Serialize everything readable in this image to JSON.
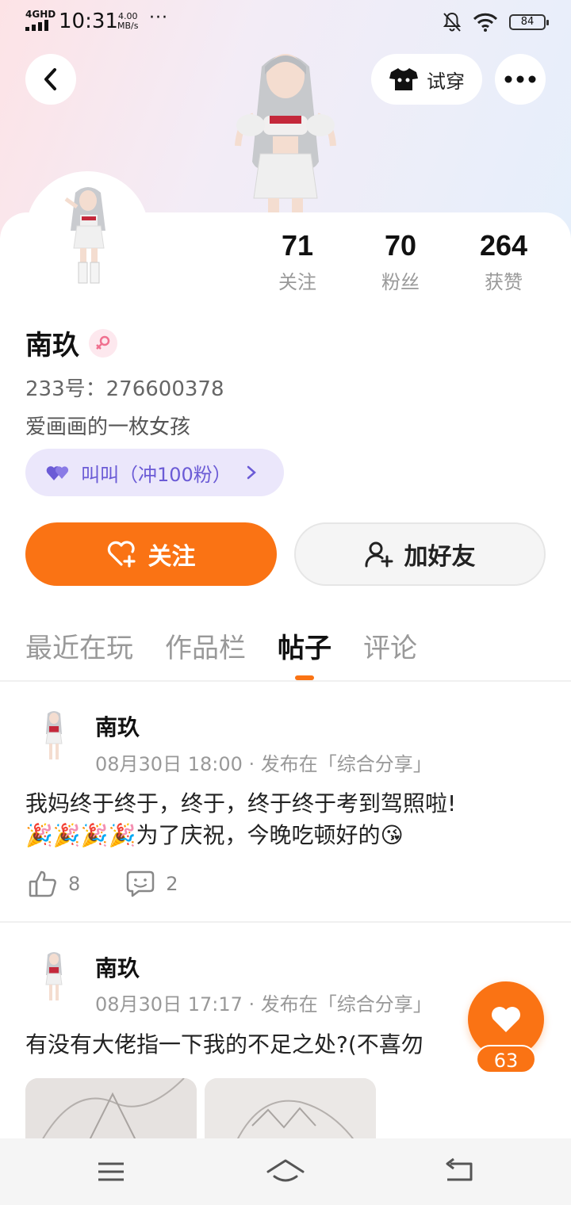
{
  "status_bar": {
    "network": "4GHD",
    "time": "10:31",
    "speed": "4.00",
    "speed_unit": "MB/s",
    "dots": "···",
    "battery": "84"
  },
  "header": {
    "tryon_label": "试穿"
  },
  "profile": {
    "name": "南玖",
    "uid": "233号：276600378",
    "bio": "爱画画的一枚女孩",
    "tag": "叫叫（冲100粉）",
    "stats": [
      {
        "value": "71",
        "label": "关注"
      },
      {
        "value": "70",
        "label": "粉丝"
      },
      {
        "value": "264",
        "label": "获赞"
      }
    ]
  },
  "actions": {
    "follow_label": "关注",
    "add_friend_label": "加好友"
  },
  "tabs": [
    "最近在玩",
    "作品栏",
    "帖子",
    "评论"
  ],
  "active_tab": "帖子",
  "posts": [
    {
      "author": "南玖",
      "meta": "08月30日 18:00 · 发布在「综合分享」",
      "text_line1": "我妈终于终于，终于，终于终于考到驾照啦!",
      "text_line2": "🎉🎉🎉🎉为了庆祝，今晚吃顿好的😘",
      "likes": "8",
      "comments": "2"
    },
    {
      "author": "南玖",
      "meta": "08月30日 17:17 · 发布在「综合分享」",
      "text_line1": "有没有大佬指一下我的不足之处?(不喜勿"
    }
  ],
  "floating_like": {
    "count": "63"
  },
  "colors": {
    "accent": "#fa7314",
    "tag_bg": "#ebe7fb",
    "tag_text": "#6b5bd6"
  }
}
